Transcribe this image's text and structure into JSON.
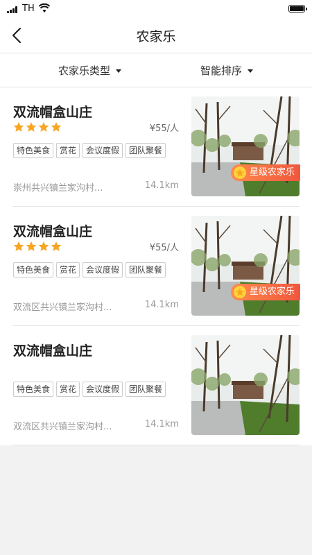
{
  "status": {
    "carrier": "TH"
  },
  "nav": {
    "title": "农家乐"
  },
  "filters": [
    {
      "label": "农家乐类型"
    },
    {
      "label": "智能排序"
    }
  ],
  "colors": {
    "star": "#f6a623",
    "badge_start": "#ff8a4c",
    "badge_end": "#f0563d"
  },
  "icons": {
    "back": "chevron-left-icon",
    "star": "star-icon",
    "caret": "caret-down-icon",
    "photo": "park-photo"
  },
  "cards": [
    {
      "name": "双流帽盒山庄",
      "rating": 4,
      "price": "¥55/人",
      "tags": [
        "特色美食",
        "赏花",
        "会议度假",
        "团队聚餐"
      ],
      "address": "崇州共兴镇兰家沟村...",
      "distance": "14.1km",
      "badge": "星级农家乐"
    },
    {
      "name": "双流帽盒山庄",
      "rating": 4,
      "price": "¥55/人",
      "tags": [
        "特色美食",
        "赏花",
        "会议度假",
        "团队聚餐"
      ],
      "address": "双流区共兴镇兰家沟村...",
      "distance": "14.1km",
      "badge": "星级农家乐"
    },
    {
      "name": "双流帽盒山庄",
      "rating": 0,
      "price": "",
      "tags": [
        "特色美食",
        "赏花",
        "会议度假",
        "团队聚餐"
      ],
      "address": "双流区共兴镇兰家沟村...",
      "distance": "14.1km",
      "badge": ""
    }
  ]
}
